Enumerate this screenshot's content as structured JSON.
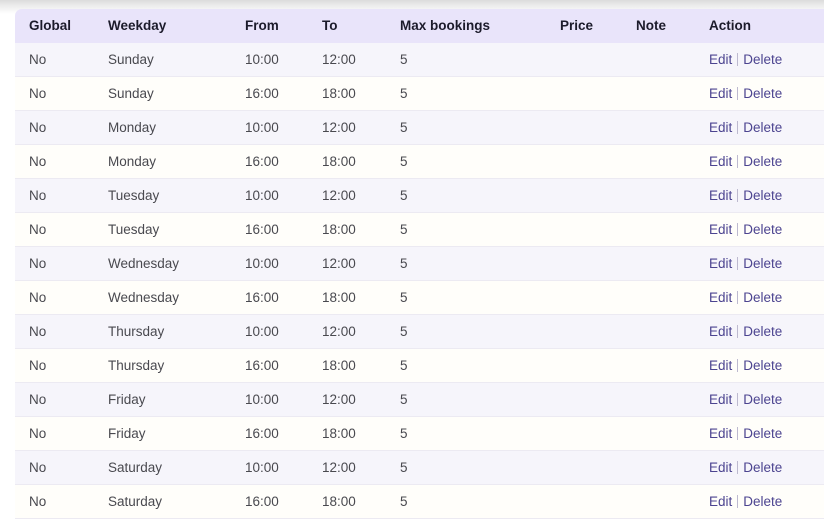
{
  "table": {
    "columns": [
      {
        "key": "global",
        "label": "Global"
      },
      {
        "key": "weekday",
        "label": "Weekday"
      },
      {
        "key": "from",
        "label": "From"
      },
      {
        "key": "to",
        "label": "To"
      },
      {
        "key": "max",
        "label": "Max bookings"
      },
      {
        "key": "price",
        "label": "Price"
      },
      {
        "key": "note",
        "label": "Note"
      },
      {
        "key": "action",
        "label": "Action"
      }
    ],
    "actions": {
      "edit_label": "Edit",
      "delete_label": "Delete",
      "separator": "|"
    },
    "rows": [
      {
        "global": "No",
        "weekday": "Sunday",
        "from": "10:00",
        "to": "12:00",
        "max": "5",
        "price": "",
        "note": ""
      },
      {
        "global": "No",
        "weekday": "Sunday",
        "from": "16:00",
        "to": "18:00",
        "max": "5",
        "price": "",
        "note": ""
      },
      {
        "global": "No",
        "weekday": "Monday",
        "from": "10:00",
        "to": "12:00",
        "max": "5",
        "price": "",
        "note": ""
      },
      {
        "global": "No",
        "weekday": "Monday",
        "from": "16:00",
        "to": "18:00",
        "max": "5",
        "price": "",
        "note": ""
      },
      {
        "global": "No",
        "weekday": "Tuesday",
        "from": "10:00",
        "to": "12:00",
        "max": "5",
        "price": "",
        "note": ""
      },
      {
        "global": "No",
        "weekday": "Tuesday",
        "from": "16:00",
        "to": "18:00",
        "max": "5",
        "price": "",
        "note": ""
      },
      {
        "global": "No",
        "weekday": "Wednesday",
        "from": "10:00",
        "to": "12:00",
        "max": "5",
        "price": "",
        "note": ""
      },
      {
        "global": "No",
        "weekday": "Wednesday",
        "from": "16:00",
        "to": "18:00",
        "max": "5",
        "price": "",
        "note": ""
      },
      {
        "global": "No",
        "weekday": "Thursday",
        "from": "10:00",
        "to": "12:00",
        "max": "5",
        "price": "",
        "note": ""
      },
      {
        "global": "No",
        "weekday": "Thursday",
        "from": "16:00",
        "to": "18:00",
        "max": "5",
        "price": "",
        "note": ""
      },
      {
        "global": "No",
        "weekday": "Friday",
        "from": "10:00",
        "to": "12:00",
        "max": "5",
        "price": "",
        "note": ""
      },
      {
        "global": "No",
        "weekday": "Friday",
        "from": "16:00",
        "to": "18:00",
        "max": "5",
        "price": "",
        "note": ""
      },
      {
        "global": "No",
        "weekday": "Saturday",
        "from": "10:00",
        "to": "12:00",
        "max": "5",
        "price": "",
        "note": ""
      },
      {
        "global": "No",
        "weekday": "Saturday",
        "from": "16:00",
        "to": "18:00",
        "max": "5",
        "price": "",
        "note": ""
      }
    ]
  },
  "colors": {
    "header_bg": "#e9e4fa",
    "row_odd_bg": "#f6f5fb",
    "row_even_bg": "#fffefa",
    "link": "#4c4490",
    "header_text": "#1c1b2b",
    "cell_text": "#49494f"
  }
}
